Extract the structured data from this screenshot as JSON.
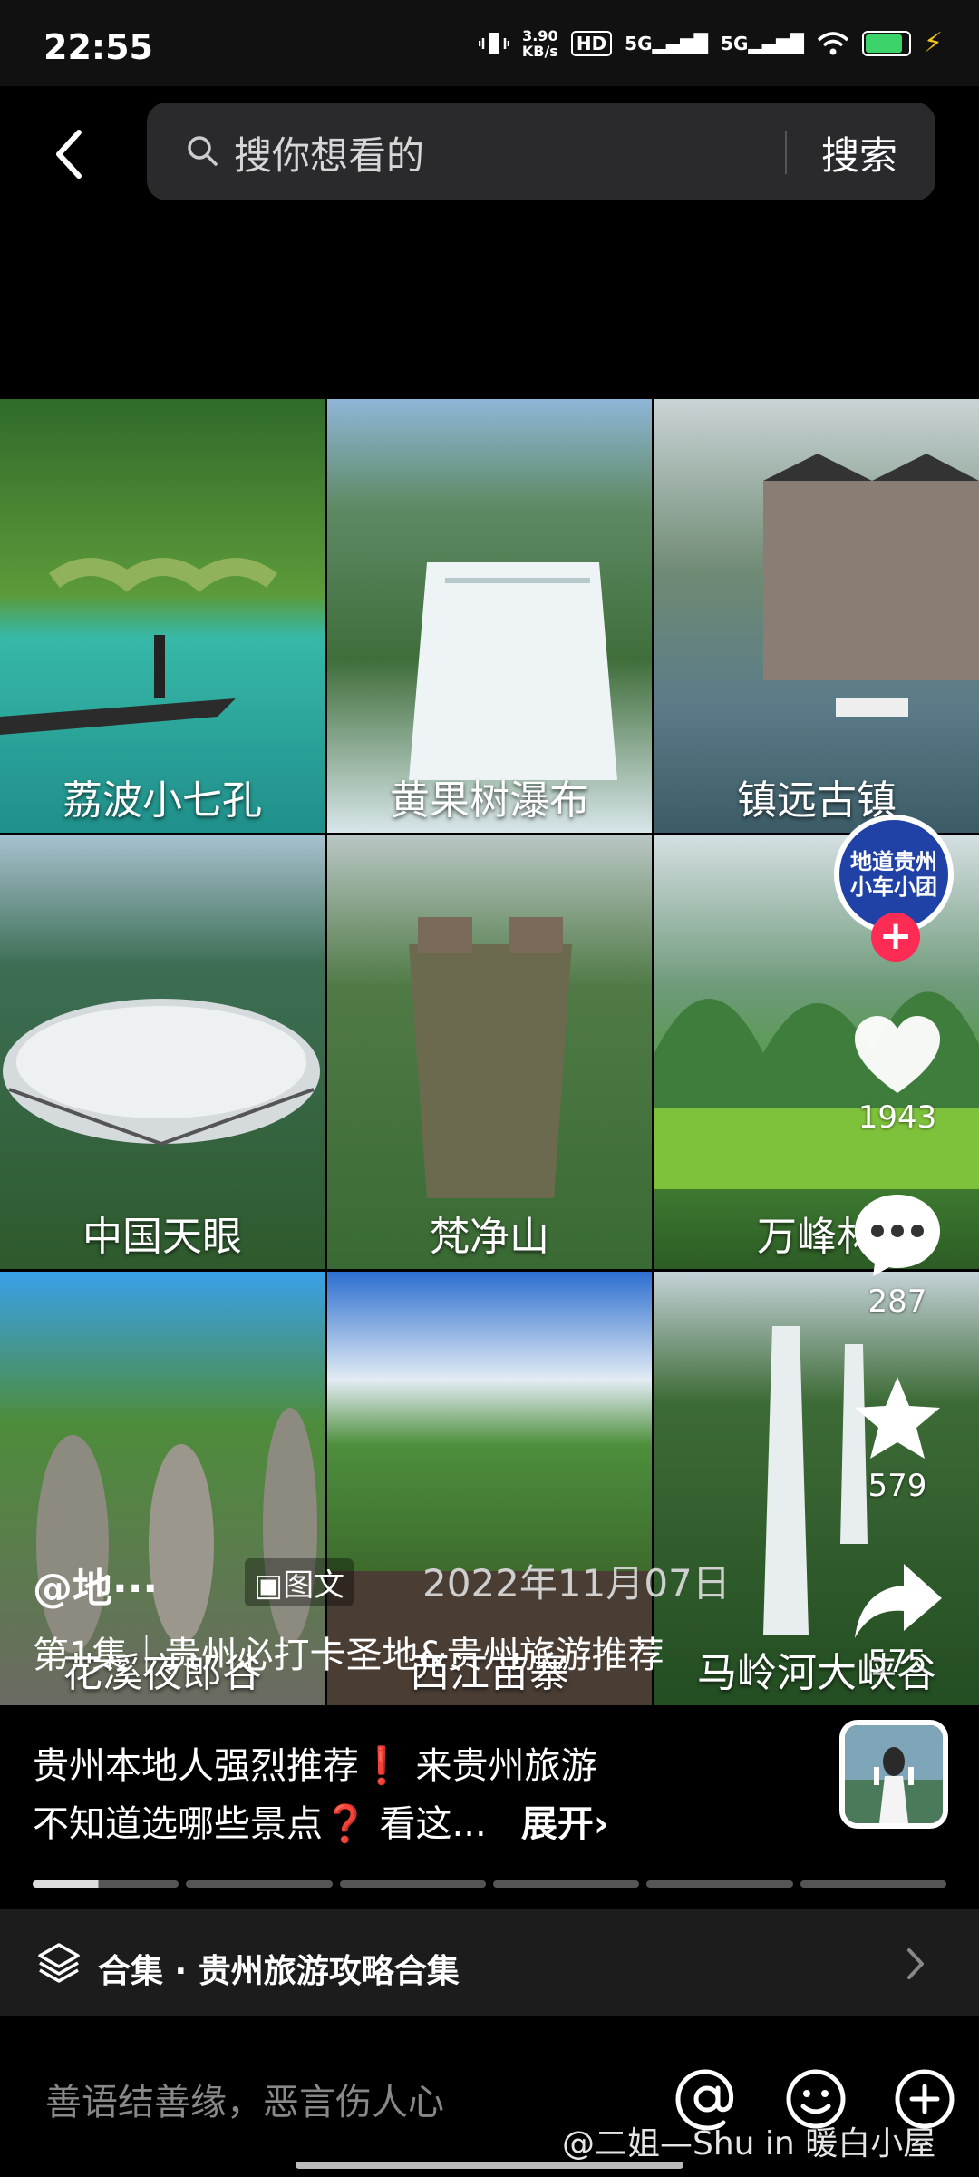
{
  "status_bar": {
    "time": "22:55",
    "speed_value": "3.90",
    "speed_unit": "KB/s",
    "hd_badge": "HD",
    "sig1": "5G",
    "sig2": "5G"
  },
  "search": {
    "back_icon": "back-chevron-icon",
    "placeholder": "搜你想看的",
    "button": "搜索"
  },
  "grid": {
    "items": [
      {
        "label": "荔波小七孔"
      },
      {
        "label": "黄果树瀑布"
      },
      {
        "label": "镇远古镇"
      },
      {
        "label": "中国天眼"
      },
      {
        "label": "梵净山"
      },
      {
        "label": "万峰林"
      },
      {
        "label": "花溪夜郎谷"
      },
      {
        "label": "西江苗寨"
      },
      {
        "label": "马岭河大峡谷"
      }
    ]
  },
  "side_actions": {
    "avatar_text_line1": "地道贵州",
    "avatar_text_line2": "小车小团",
    "follow_plus": "+",
    "likes": "1943",
    "comments": "287",
    "favorites": "579",
    "shares": "575"
  },
  "post": {
    "author": "@地···",
    "type_tag": "图文",
    "date": "2022年11月07日",
    "title": "第1集｜贵州必打卡圣地&贵州旅游推荐",
    "desc_line1": "贵州本地人强烈推荐❗ 来贵州旅游",
    "desc_line2": "不知道选哪些景点❓ 看这...",
    "expand": "展开›"
  },
  "collection": {
    "label": "合集 · 贵州旅游攻略合集"
  },
  "comment_bar": {
    "placeholder": "善语结善缘，恶言伤人心"
  },
  "watermark": "@二姐—Shu in 暖白小屋",
  "colors": {
    "accent_red": "#fe2c55",
    "battery_green": "#3bd36a",
    "bg": "#000000"
  }
}
